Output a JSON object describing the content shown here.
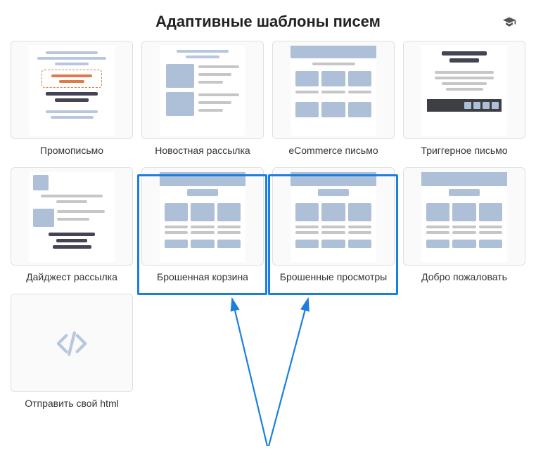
{
  "header": {
    "title": "Адаптивные шаблоны писем"
  },
  "templates": [
    {
      "label": "Промописьмо"
    },
    {
      "label": "Новостная рассылка"
    },
    {
      "label": "eCommerce письмо"
    },
    {
      "label": "Триггерное письмо"
    },
    {
      "label": "Дайджест рассылка"
    },
    {
      "label": "Брошенная корзина"
    },
    {
      "label": "Брошенные просмотры"
    },
    {
      "label": "Добро пожаловать"
    },
    {
      "label": "Отправить свой html"
    }
  ],
  "highlight": {
    "color": "#1b7fe0",
    "selected_indices": [
      5,
      6
    ]
  }
}
